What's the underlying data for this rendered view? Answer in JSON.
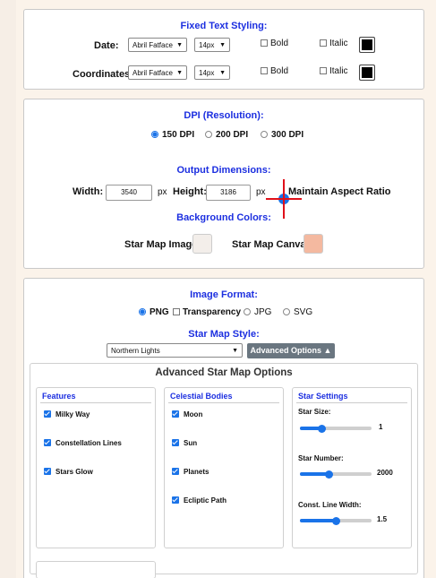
{
  "fixed_text": {
    "title": "Fixed Text Styling:",
    "rows": [
      {
        "label": "Date:",
        "font": "Abril Fatface",
        "size": "14px",
        "bold": "Bold",
        "italic": "Italic"
      },
      {
        "label": "Coordinates:",
        "font": "Abril Fatface",
        "size": "14px",
        "bold": "Bold",
        "italic": "Italic"
      }
    ]
  },
  "dpi": {
    "title": "DPI (Resolution):",
    "options": [
      "150 DPI",
      "200 DPI",
      "300 DPI"
    ],
    "selected": "150 DPI",
    "output_title": "Output Dimensions:",
    "width_label": "Width:",
    "width_value": "3540",
    "height_label": "Height:",
    "height_value": "3186",
    "unit": "px",
    "aspect_label": "Maintain Aspect Ratio",
    "bg_title": "Background Colors:",
    "star_map_image_label": "Star Map Image:",
    "star_map_canvas_label": "Star Map Canvas:",
    "colors": {
      "image": "#f3eeea",
      "canvas": "#f4b9a0"
    }
  },
  "format": {
    "title": "Image Format:",
    "options": [
      "PNG",
      "Transparency",
      "JPG",
      "SVG"
    ],
    "selected": "PNG",
    "style_title": "Star Map Style:",
    "style_value": "Northern Lights",
    "advanced_button": "Advanced Options ▲"
  },
  "advanced": {
    "title": "Advanced Star Map Options",
    "features": {
      "title": "Features",
      "items": [
        "Milky Way",
        "Constellation Lines",
        "Stars Glow"
      ]
    },
    "celestial": {
      "title": "Celestial Bodies",
      "items": [
        "Moon",
        "Sun",
        "Planets",
        "Ecliptic Path"
      ]
    },
    "settings": {
      "title": "Star Settings",
      "sliders": [
        {
          "label": "Star Size:",
          "value": "1",
          "fraction": 0.3
        },
        {
          "label": "Star Number:",
          "value": "2000",
          "fraction": 0.4
        },
        {
          "label": "Const. Line Width:",
          "value": "1.5",
          "fraction": 0.5
        }
      ]
    }
  },
  "colors": {
    "accent": "#1a73e8",
    "heading_blue": "#1c2fe0",
    "cursor_red": "#e0101a"
  }
}
